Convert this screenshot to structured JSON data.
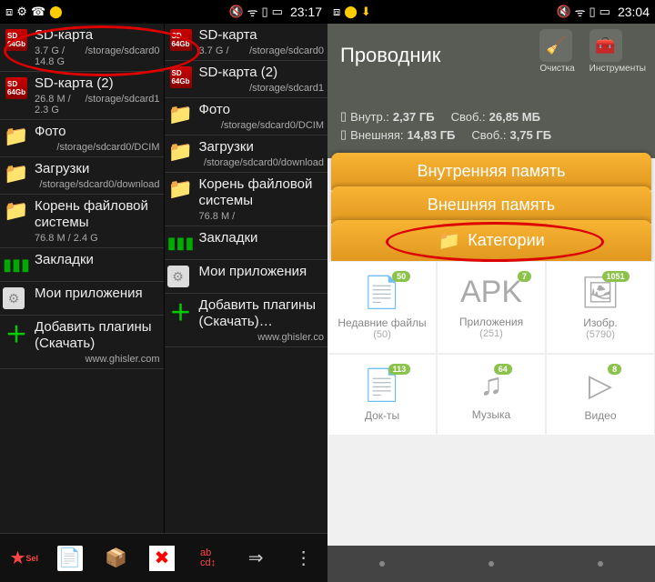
{
  "left": {
    "statusbar": {
      "time": "23:17"
    },
    "panes": [
      {
        "entries": [
          {
            "icon": "sd",
            "title": "SD-карта",
            "size": "3.7 G / 14.8 G",
            "path": "/storage/sdcard0"
          },
          {
            "icon": "sd",
            "title": "SD-карта (2)",
            "size": "26.8 M / 2.3 G",
            "path": "/storage/sdcard1"
          },
          {
            "icon": "folder",
            "title": "Фото",
            "size": "",
            "path": "/storage/sdcard0/DCIM"
          },
          {
            "icon": "folder",
            "title": "Загрузки",
            "size": "",
            "path": "/storage/sdcard0/download"
          },
          {
            "icon": "folder",
            "title": "Корень файловой системы",
            "size": "76.8 M / 2.4 G",
            "path": ""
          },
          {
            "icon": "bars",
            "title": "Закладки",
            "size": "",
            "path": ""
          },
          {
            "icon": "app",
            "title": "Мои приложения",
            "size": "",
            "path": ""
          },
          {
            "icon": "plus",
            "title": "Добавить плагины (Скачать)",
            "size": "",
            "path": "www.ghisler.com"
          }
        ]
      },
      {
        "entries": [
          {
            "icon": "sd",
            "title": "SD-карта",
            "size": "3.7 G /",
            "path": "/storage/sdcard0"
          },
          {
            "icon": "sd",
            "title": "SD-карта (2)",
            "size": "",
            "path": "/storage/sdcard1"
          },
          {
            "icon": "folder",
            "title": "Фото",
            "size": "",
            "path": "/storage/sdcard0/DCIM"
          },
          {
            "icon": "folder",
            "title": "Загрузки",
            "size": "",
            "path": "/storage/sdcard0/download"
          },
          {
            "icon": "folder",
            "title": "Корень файловой системы",
            "size": "76.8 M /",
            "path": ""
          },
          {
            "icon": "bars",
            "title": "Закладки",
            "size": "",
            "path": ""
          },
          {
            "icon": "app",
            "title": "Мои приложения",
            "size": "",
            "path": ""
          },
          {
            "icon": "plus",
            "title": "Добавить плагины (Скачать)…",
            "size": "",
            "path": "www.ghisler.co"
          }
        ]
      }
    ]
  },
  "right": {
    "statusbar": {
      "time": "23:04"
    },
    "header": {
      "title": "Проводник",
      "clean": "Очистка",
      "tools": "Инструменты"
    },
    "storage": {
      "internal_lbl": "Внутр.:",
      "internal_val": "2,37 ГБ",
      "internal_free_lbl": "Своб.:",
      "internal_free": "26,85 МБ",
      "external_lbl": "Внешняя:",
      "external_val": "14,83 ГБ",
      "external_free_lbl": "Своб.:",
      "external_free": "3,75 ГБ"
    },
    "tabs": {
      "internal": "Внутренняя память",
      "external": "Внешняя память",
      "categories": "Категории"
    },
    "grid": [
      {
        "title": "Недавние файлы",
        "count": "(50)",
        "badge": "50"
      },
      {
        "title": "Приложения",
        "count": "(251)",
        "badge": "7"
      },
      {
        "title": "Изобр.",
        "count": "(5790)",
        "badge": "1051"
      },
      {
        "title": "Док-ты",
        "count": "",
        "badge": "113"
      },
      {
        "title": "Музыка",
        "count": "",
        "badge": "64"
      },
      {
        "title": "Видео",
        "count": "",
        "badge": "8"
      }
    ]
  }
}
